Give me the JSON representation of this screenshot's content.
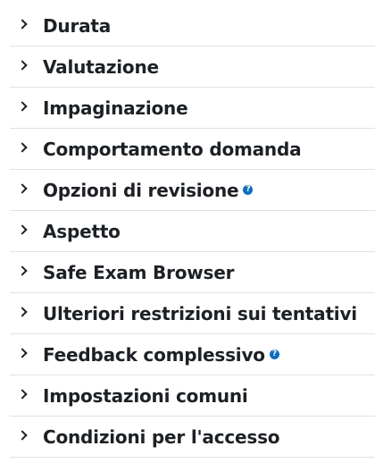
{
  "sections": [
    {
      "label": "Durata",
      "has_help": false
    },
    {
      "label": "Valutazione",
      "has_help": false
    },
    {
      "label": "Impaginazione",
      "has_help": false
    },
    {
      "label": "Comportamento domanda",
      "has_help": false
    },
    {
      "label": "Opzioni di revisione",
      "has_help": true
    },
    {
      "label": "Aspetto",
      "has_help": false
    },
    {
      "label": "Safe Exam Browser",
      "has_help": false
    },
    {
      "label": "Ulteriori restrizioni sui tentativi",
      "has_help": false
    },
    {
      "label": "Feedback complessivo",
      "has_help": true
    },
    {
      "label": "Impostazioni comuni",
      "has_help": false
    },
    {
      "label": "Condizioni per l'accesso",
      "has_help": false
    }
  ],
  "icons": {
    "expand": "chevron-right-icon",
    "help": "question-circle-icon",
    "help_glyph": "?"
  },
  "colors": {
    "text": "#1d2125",
    "help_icon": "#0f6cbf",
    "divider": "#dee2e6"
  }
}
